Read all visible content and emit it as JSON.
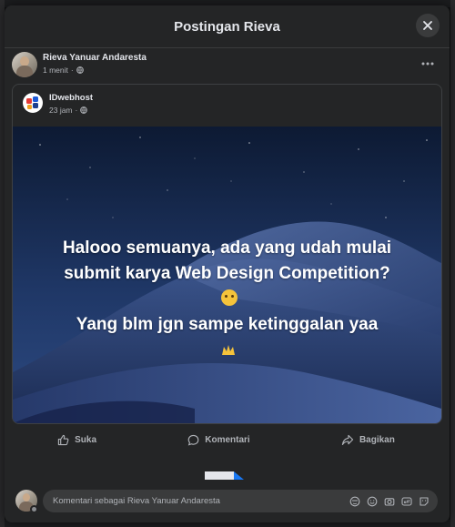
{
  "dialog": {
    "title": "Postingan Rieva",
    "close_icon": "close-icon"
  },
  "post": {
    "author": "Rieva Yanuar Andaresta",
    "time": "1 menit",
    "separator": "·",
    "audience_icon": "globe-icon",
    "more_icon": "more-dots-icon"
  },
  "shared_post": {
    "page_name": "IDwebhost",
    "time": "23 jam",
    "separator": "·",
    "audience_icon": "globe-icon",
    "caption": [
      "Halooo semuanya, ada yang udah mulai",
      "submit karya Web Design Competition?",
      "Yang blm jgn sampe ketinggalan yaa"
    ],
    "caption_emojis": [
      "thinking-face-emoji",
      "raising-hands-emoji"
    ]
  },
  "actions": {
    "like": "Suka",
    "comment": "Komentari",
    "share": "Bagikan"
  },
  "comment": {
    "placeholder": "Komentari sebagai Rieva Yanuar Andaresta",
    "tools": [
      "avatar-sticker-icon",
      "emoji-icon",
      "camera-icon",
      "gif-icon",
      "sticker-icon"
    ]
  },
  "colors": {
    "dialog_bg": "#242526",
    "text_primary": "#e4e6eb",
    "text_secondary": "#b0b3b8",
    "media_bg": "#1a2b4a",
    "loader_accent": "#1877f2"
  }
}
